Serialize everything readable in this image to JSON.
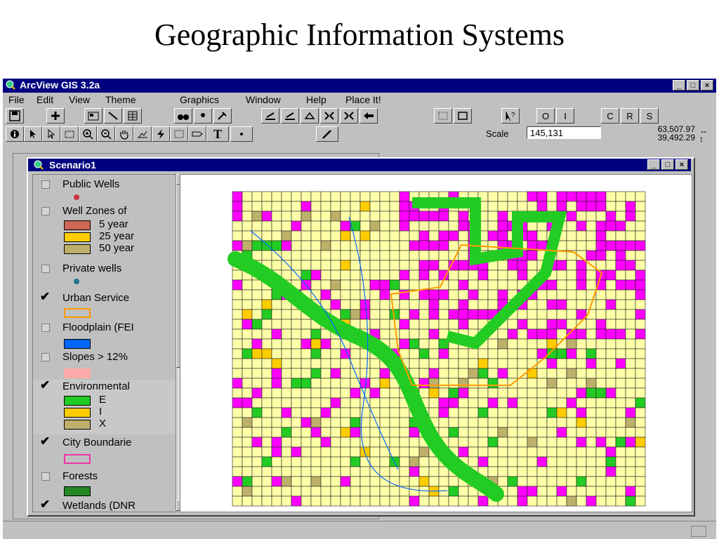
{
  "slide": {
    "title": "Geographic Information Systems"
  },
  "app": {
    "title": "ArcView GIS 3.2a",
    "menu": [
      "File",
      "Edit",
      "View",
      "Theme",
      "Graphics",
      "Window",
      "Help",
      "Place It!"
    ]
  },
  "toolbar": {
    "scale_label": "Scale",
    "scale_value": "145,131",
    "coord_x": "63,507.97",
    "coord_y": "39,492.29",
    "button_letters": [
      "O",
      "I",
      "C",
      "R",
      "S"
    ],
    "text_tool": "T"
  },
  "view_window": {
    "title": "Scenario1",
    "legend": [
      {
        "name": "Public Wells",
        "checked": false
      },
      {
        "name": "Well Zones of",
        "checked": false,
        "classes": [
          "5 year",
          "25 year",
          "50 year"
        ]
      },
      {
        "name": "Private wells",
        "checked": false
      },
      {
        "name": "Urban Service",
        "checked": true
      },
      {
        "name": "Floodplain (FEI",
        "checked": false
      },
      {
        "name": "Slopes > 12%",
        "checked": false
      },
      {
        "name": "Environmental",
        "checked": true,
        "classes": [
          "E",
          "I",
          "X"
        ]
      },
      {
        "name": "City Boundarie",
        "checked": true
      },
      {
        "name": "Forests",
        "checked": false
      },
      {
        "name": "Wetlands (DNR",
        "checked": true
      }
    ]
  },
  "colors": {
    "titlebar": "#000080",
    "chrome": "#c0c0c0",
    "public_wells": "#cc3344",
    "well_5yr": "#cc6655",
    "well_25yr": "#ffcc00",
    "well_50yr": "#bdb06a",
    "private_wells": "#22778a",
    "urban_service": "#ff9900",
    "floodplain": "#0066ff",
    "slopes": "#ffaaaa",
    "env_e": "#22cc22",
    "env_i": "#ffcc00",
    "env_x": "#bdb06a",
    "city_boundaries": "#ee33aa",
    "forests": "#228822",
    "map_parcel": "#ffffa8",
    "map_urban": "#ff00ff"
  }
}
